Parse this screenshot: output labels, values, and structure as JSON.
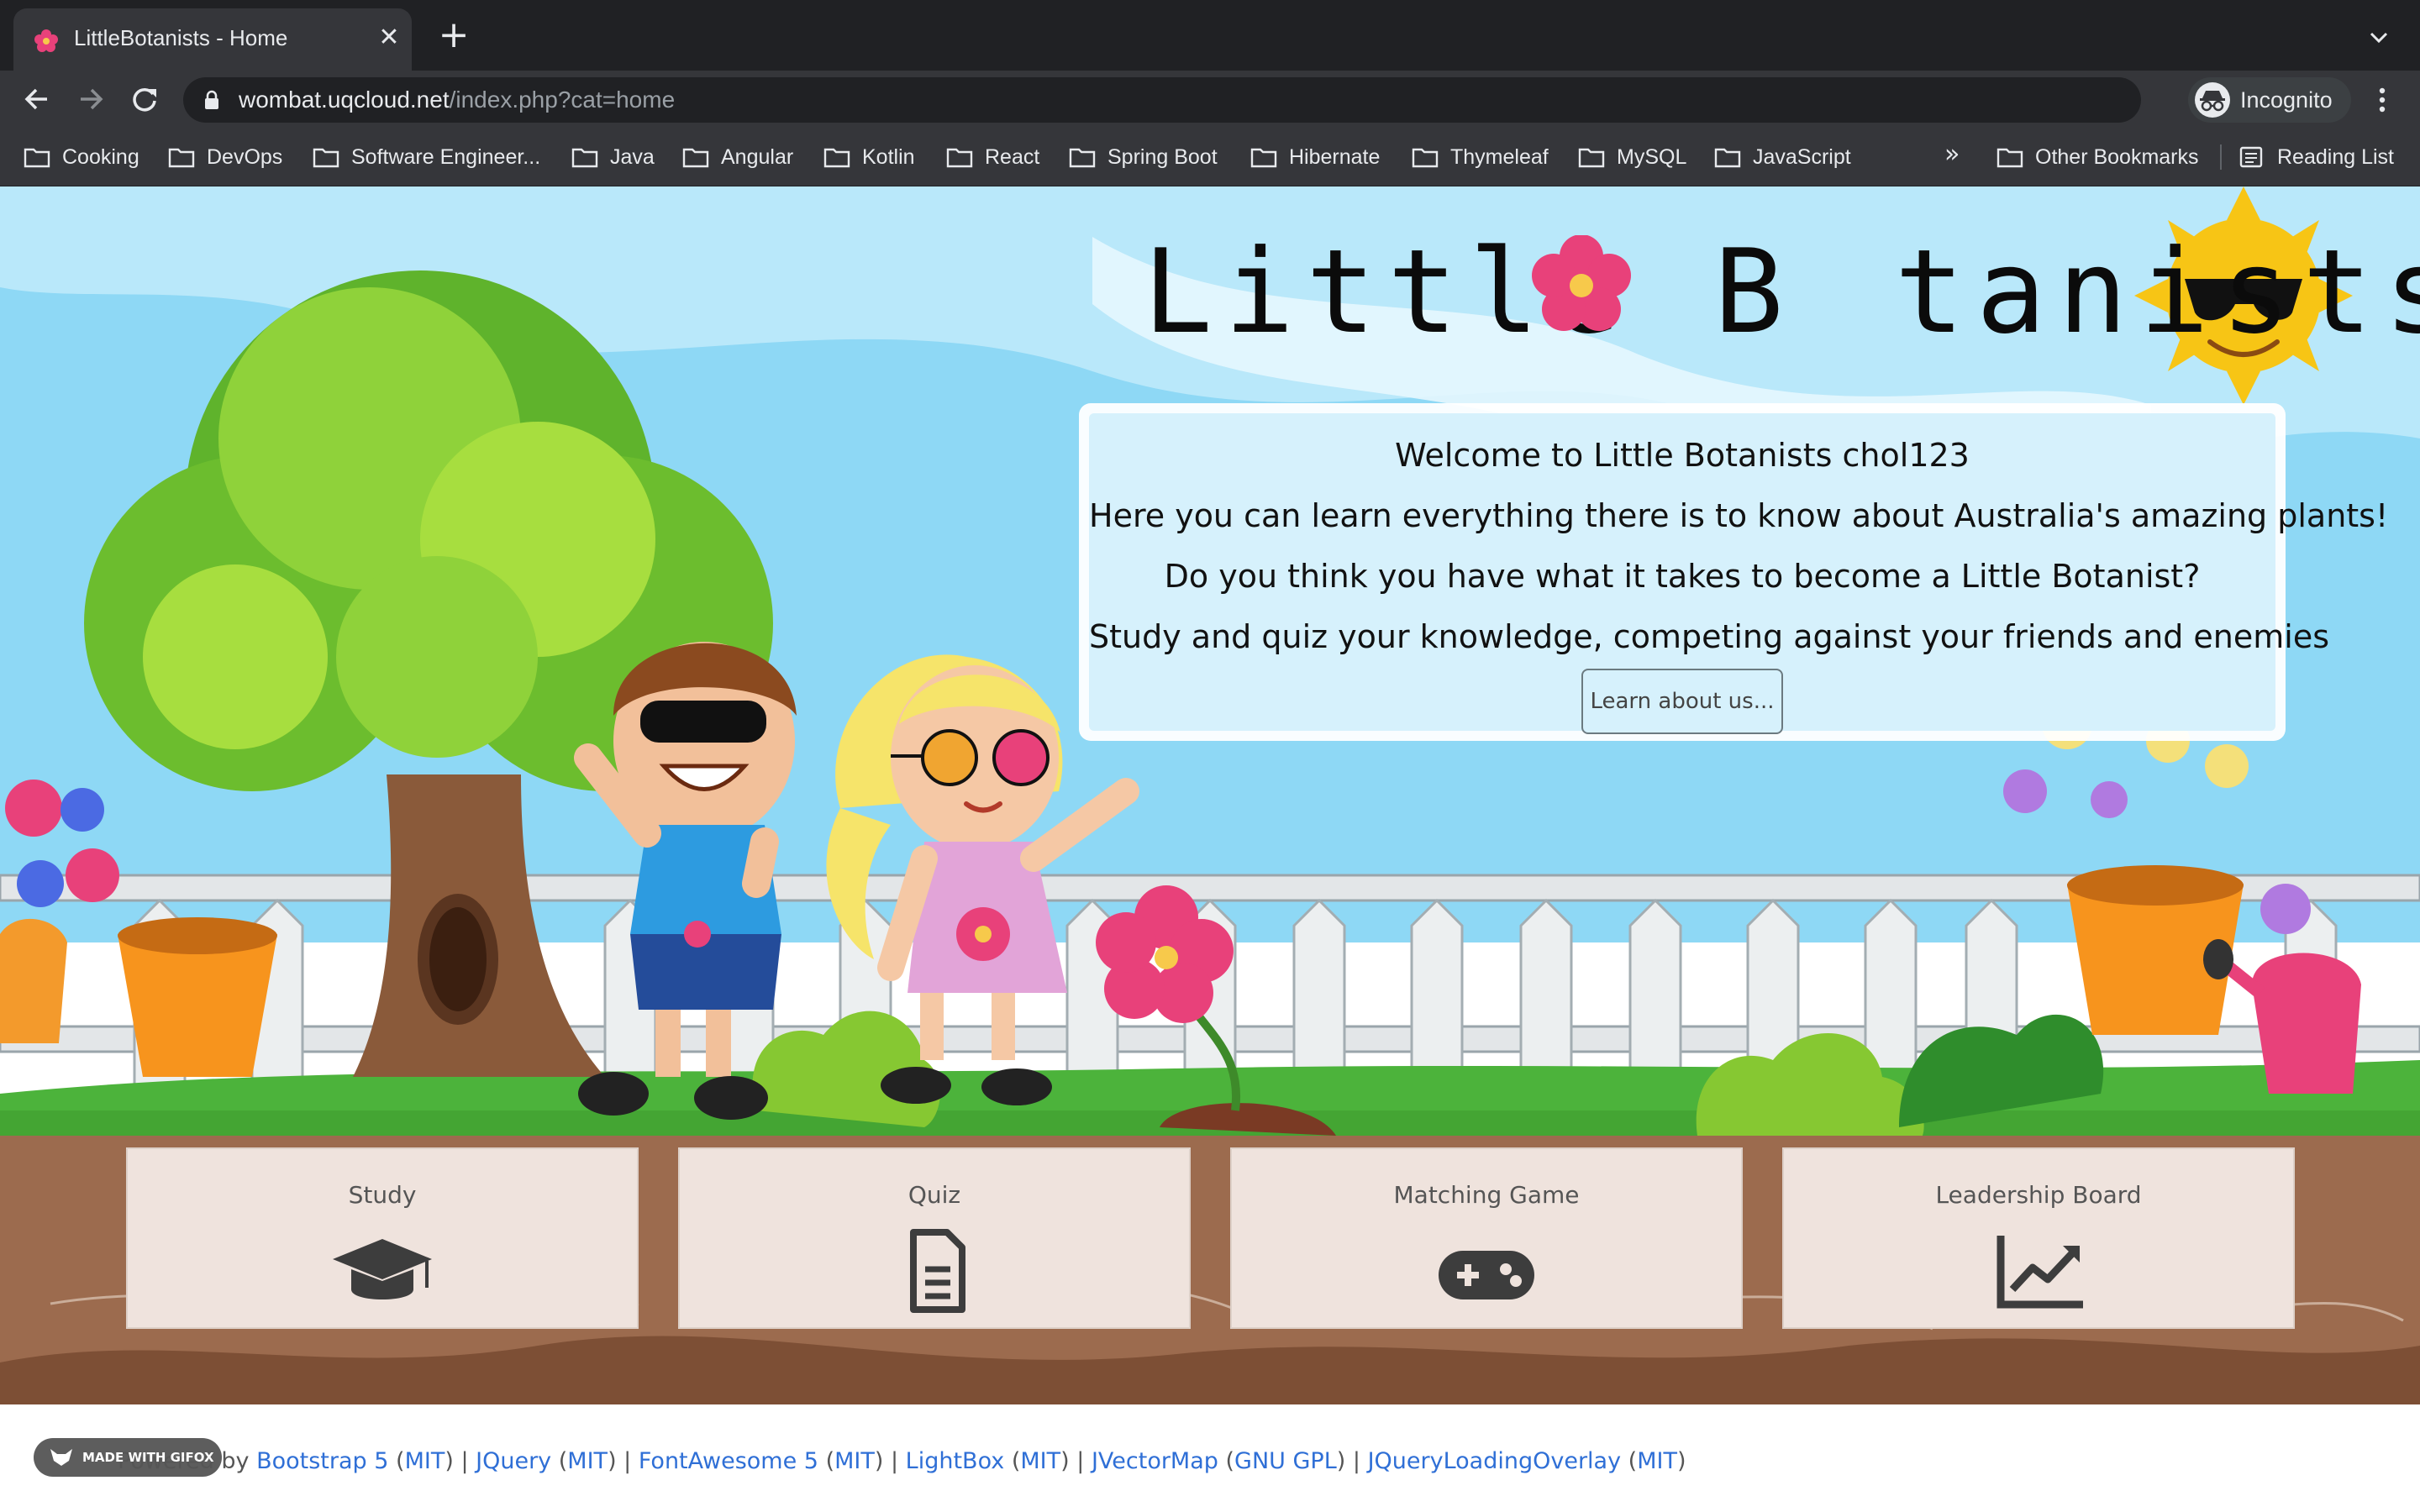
{
  "browser": {
    "tab_title": "LittleBotanists - Home",
    "tab_close": "✕",
    "new_tab": "+",
    "url_host": "wombat.uqcloud.net",
    "url_path": "/index.php?cat=home",
    "incognito_label": "Incognito",
    "bookmarks": [
      "Cooking",
      "DevOps",
      "Software Engineer...",
      "Java",
      "Angular",
      "Kotlin",
      "React",
      "Spring Boot",
      "Hibernate",
      "Thymeleaf",
      "MySQL",
      "JavaScript"
    ],
    "bookmarks_overflow": "»",
    "other_bookmarks": "Other Bookmarks",
    "reading_list": "Reading List"
  },
  "site": {
    "title_prefix": "Little B",
    "title_suffix": "tanists.",
    "welcome_lines": [
      "Welcome to Little Botanists chol123",
      "Here you can learn everything there is to know about Australia's amazing plants!",
      "Do you think you have what it takes to become a Little Botanist?",
      "Study and quiz your knowledge, competing against your friends and enemies"
    ],
    "learn_button": "Learn about us..."
  },
  "cards": [
    {
      "label": "Study",
      "icon": "graduation-cap-icon"
    },
    {
      "label": "Quiz",
      "icon": "file-document-icon"
    },
    {
      "label": "Matching Game",
      "icon": "gamepad-icon"
    },
    {
      "label": "Leadership Board",
      "icon": "chart-line-icon"
    }
  ],
  "footer": {
    "powered_by": "Powered by",
    "gifox_badge": "MADE WITH GIFOX",
    "libs": [
      {
        "name": "Bootstrap 5",
        "license": "MIT"
      },
      {
        "name": "JQuery",
        "license": "MIT"
      },
      {
        "name": "FontAwesome 5",
        "license": "MIT"
      },
      {
        "name": "LightBox",
        "license": "MIT"
      },
      {
        "name": "JVectorMap",
        "license": "GNU GPL"
      },
      {
        "name": "JQueryLoadingOverlay",
        "license": "MIT"
      }
    ]
  },
  "colors": {
    "chrome_dark": "#202124",
    "chrome_mid": "#35363a",
    "sky": "#8ed8f5",
    "grass": "#4cb33b",
    "soil": "#9c6b4e",
    "card_bg": "#efe3dd",
    "link": "#2f6fd6"
  }
}
